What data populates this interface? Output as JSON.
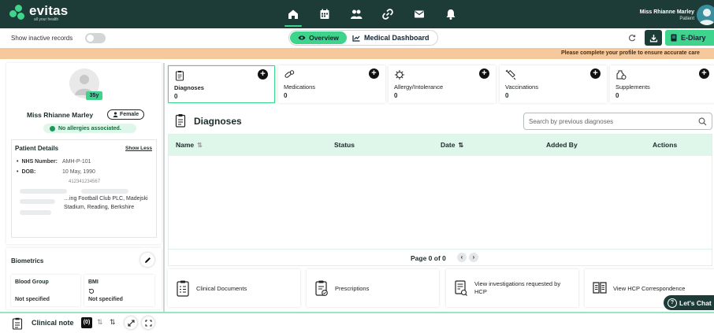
{
  "brand": {
    "name": "evitas",
    "tagline": "all your health"
  },
  "user": {
    "name": "Miss Rhianne Marley",
    "role": "Patient"
  },
  "nav": {
    "icons": [
      "home-icon",
      "calendar-icon",
      "people-icon",
      "link-icon",
      "mail-icon",
      "bell-icon"
    ],
    "active": "home-icon"
  },
  "toolbar": {
    "inactive_label": "Show inactive records",
    "overview_label": "Overview",
    "medical_dashboard_label": "Medical Dashboard",
    "ediary_label": "E-Diary"
  },
  "banner": {
    "text": "Please complete your profile to ensure accurate care"
  },
  "patient": {
    "age": "35y",
    "name": "Miss Rhianne Marley",
    "gender": "Female",
    "allergy_status": "No allergies associated.",
    "details_title": "Patient Details",
    "show_less": "Show Less",
    "nhs_label": "NHS Number:",
    "nhs_value": "AMH-P-101",
    "dob_label": "DOB:",
    "dob_value": "10 May, 1990",
    "phone_partial": "412341234567",
    "address": "…ing Football Club PLC, Madejski Stadium, Reading, Berkshire"
  },
  "biometrics": {
    "title": "Biometrics",
    "items": [
      {
        "label": "Blood Group",
        "value": "Not specified"
      },
      {
        "label": "BMI",
        "value": "Not specified"
      }
    ]
  },
  "categories": [
    {
      "label": "Diagnoses",
      "count": "0",
      "icon": "clipboard-icon"
    },
    {
      "label": "Medications",
      "count": "0",
      "icon": "pills-icon"
    },
    {
      "label": "Allergy/Intolerance",
      "count": "0",
      "icon": "virus-icon"
    },
    {
      "label": "Vaccinations",
      "count": "0",
      "icon": "syringe-icon"
    },
    {
      "label": "Supplements",
      "count": "0",
      "icon": "supplement-icon"
    }
  ],
  "diagnoses": {
    "title": "Diagnoses",
    "search_placeholder": "Search by previous diagnoses",
    "columns": [
      "Name",
      "Status",
      "Date",
      "Added By",
      "Actions"
    ],
    "rows": [],
    "pager": "Page 0 of 0"
  },
  "documents": [
    {
      "label": "Clinical Documents",
      "icon": "document-list-icon"
    },
    {
      "label": "Prescriptions",
      "icon": "prescription-icon"
    },
    {
      "label": "View investigations requested by HCP",
      "icon": "investigation-icon"
    },
    {
      "label": "View HCP Correspondence",
      "icon": "book-icon"
    }
  ],
  "chat": {
    "label": "Let's Chat"
  },
  "clinical_note": {
    "label": "Clinical note",
    "count": "(0)"
  },
  "colors": {
    "primary_dark": "#1d3b37",
    "accent_green": "#3fd48b",
    "banner": "#f5c99b"
  }
}
